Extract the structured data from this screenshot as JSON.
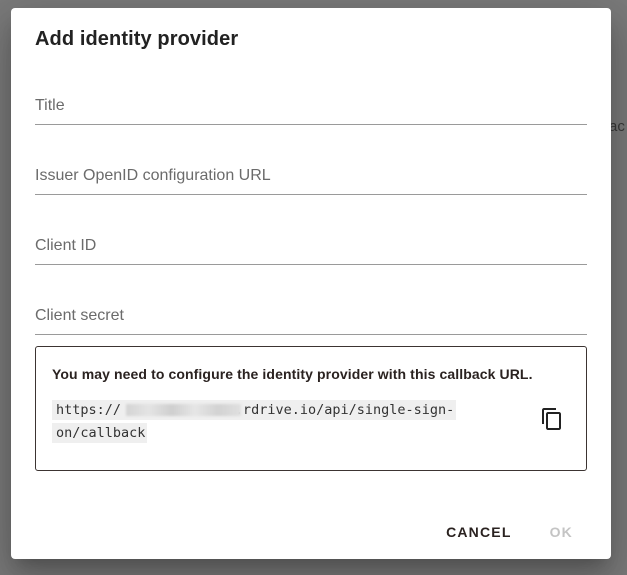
{
  "background": {
    "partial_text": "ac"
  },
  "dialog": {
    "title": "Add identity provider",
    "fields": {
      "title": {
        "placeholder": "Title",
        "value": ""
      },
      "issuer_url": {
        "placeholder": "Issuer OpenID configuration URL",
        "value": ""
      },
      "client_id": {
        "placeholder": "Client ID",
        "value": ""
      },
      "client_secret": {
        "placeholder": "Client secret",
        "value": ""
      }
    },
    "callback": {
      "message": "You may need to configure the identity provider with this callback URL.",
      "url": "https://█████████████.rdrive.io/api/single-sign-on/callback",
      "url_line1": "https://              .rdrive.io/api/single-sign-",
      "url_line2": "on/callback",
      "copy_icon": "content-copy-icon"
    },
    "actions": {
      "cancel_label": "CANCEL",
      "ok_label": "OK"
    }
  },
  "colors": {
    "backdrop": "#7a7a7a",
    "dialog": "#ffffff",
    "border": "#3c3432",
    "disabled": "#c4c4c4"
  }
}
